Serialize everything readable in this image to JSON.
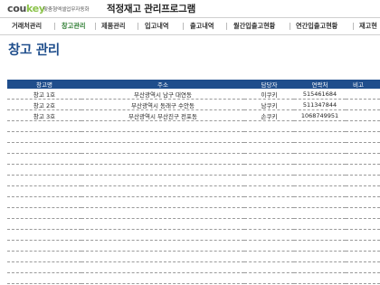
{
  "brand": {
    "logo_part1": "cou",
    "logo_part2": "key",
    "tagline": "맞춤형엑셀업무자동화",
    "app_title": "적정재고 관리프로그램"
  },
  "menu": {
    "active_index": 1,
    "items": [
      {
        "label": "거래처관리"
      },
      {
        "label": "창고관리"
      },
      {
        "label": "제품관리"
      },
      {
        "label": "입고내역"
      },
      {
        "label": "출고내역"
      },
      {
        "label": "월간입출고현황"
      },
      {
        "label": "연간입출고현황"
      },
      {
        "label": "재고현"
      }
    ]
  },
  "page": {
    "title": "창고 관리"
  },
  "table": {
    "columns": [
      "창고명",
      "주소",
      "담당자",
      "연락처",
      "비고"
    ],
    "rows": [
      {
        "name": "창고 1호",
        "address": "부산광역시 남구 대연동",
        "manager": "이쿠키",
        "phone": "515461684",
        "note": ""
      },
      {
        "name": "창고 2호",
        "address": "부산광역시 동래구 수안동",
        "manager": "남쿠키",
        "phone": "511347844",
        "note": ""
      },
      {
        "name": "창고 3호",
        "address": "부산광역시 부산진구 전포동",
        "manager": "손쿠키",
        "phone": "1068749951",
        "note": ""
      }
    ],
    "empty_row_count": 16
  },
  "colors": {
    "header_bg": "#1f4e8c",
    "title_color": "#1f4e8c",
    "active_menu": "#2e7d32",
    "brand_green": "#8bc34a"
  }
}
